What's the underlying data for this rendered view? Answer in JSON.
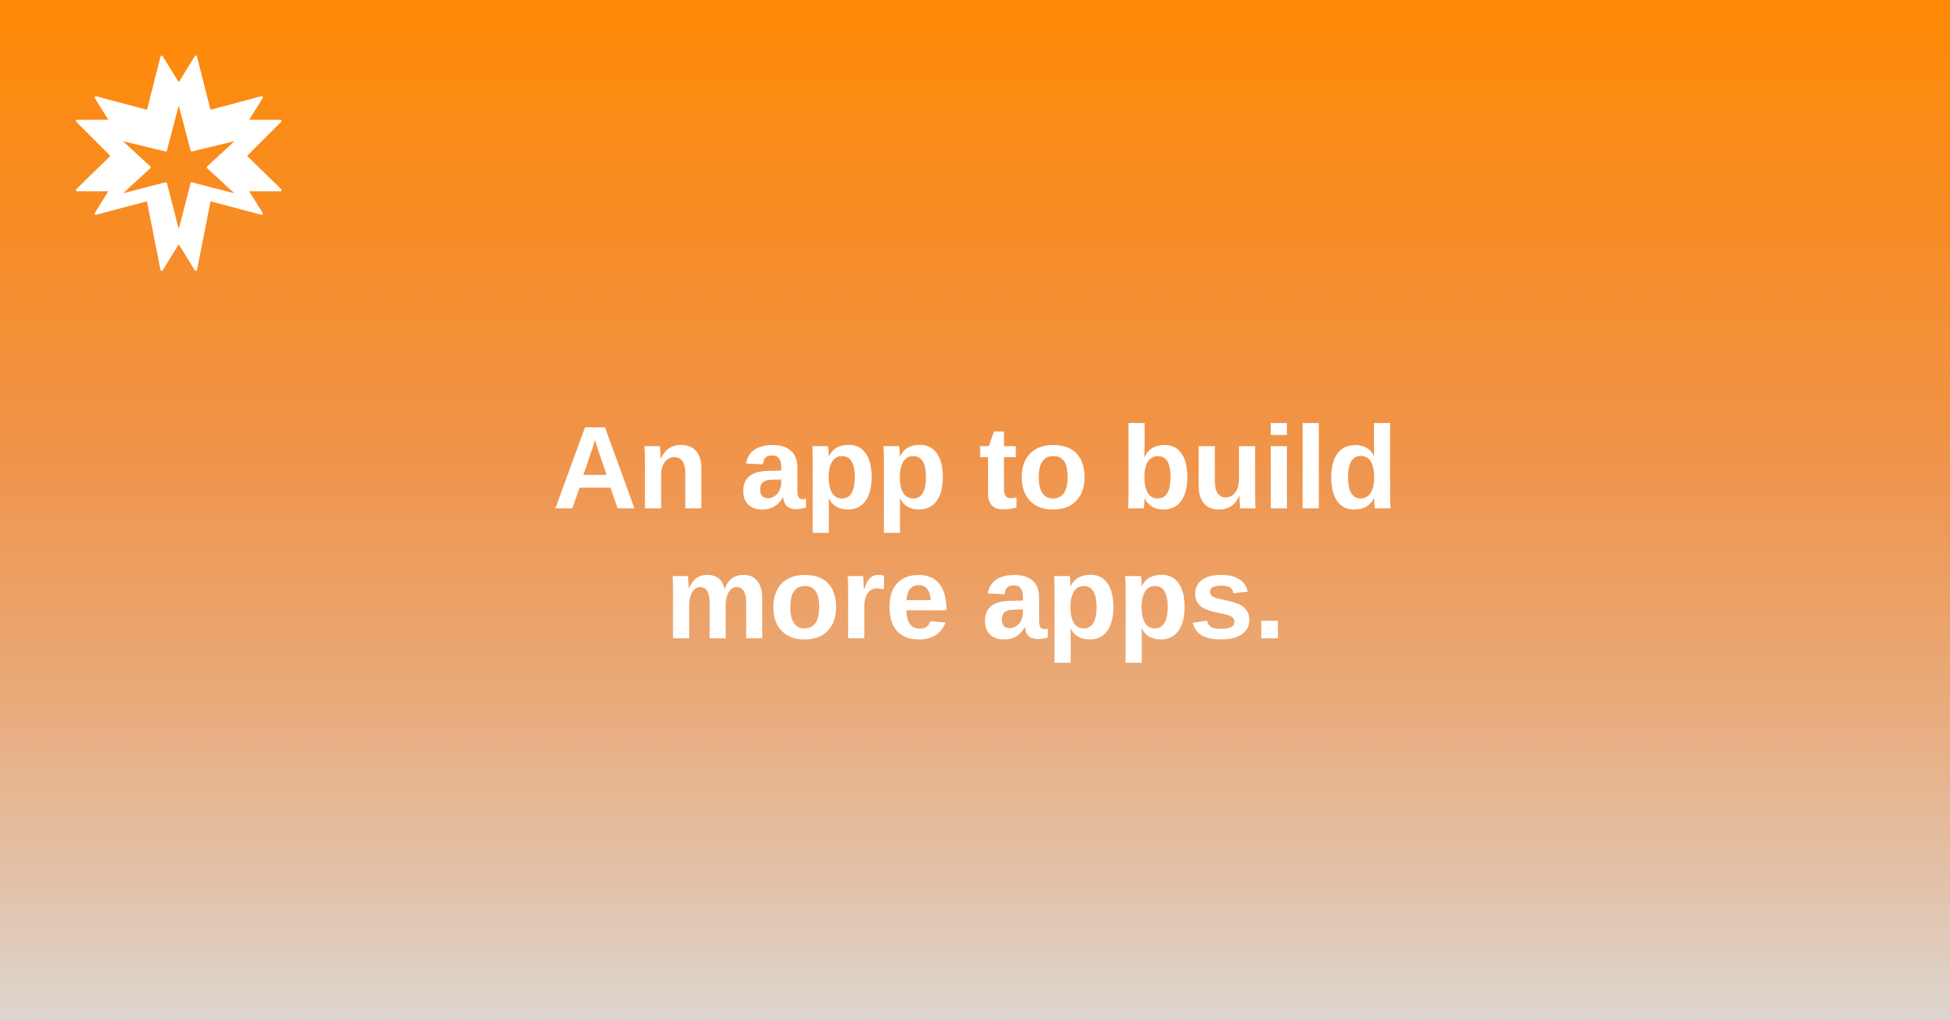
{
  "brand": {
    "logo_icon": "starburst-logo-icon",
    "logo_color": "#ffffff"
  },
  "hero": {
    "line1": "An app to build",
    "line2": "more apps."
  },
  "colors": {
    "gradient_top": "#ff8a05",
    "gradient_bottom": "#ddd6ce",
    "text": "#ffffff"
  }
}
